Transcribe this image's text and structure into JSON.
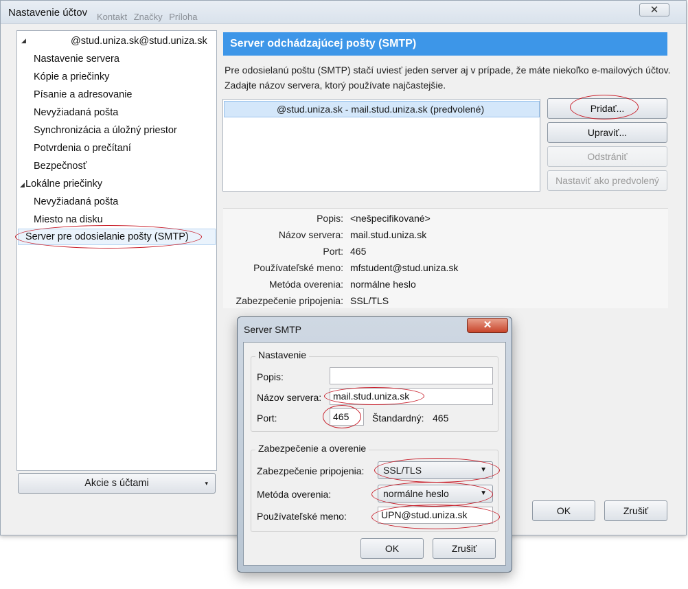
{
  "window": {
    "title": "Nastavenie účtov",
    "background_toolbar": [
      "Kontakt",
      "Značky",
      "Príloha"
    ],
    "close_glyph": "✕"
  },
  "sidebar": {
    "account": "@stud.uniza.sk@stud.uniza.sk",
    "account_items": [
      "Nastavenie servera",
      "Kópie a priečinky",
      "Písanie a adresovanie",
      "Nevyžiadaná pošta",
      "Synchronizácia a úložný priestor",
      "Potvrdenia o prečítaní",
      "Bezpečnosť"
    ],
    "local_folders": "Lokálne priečinky",
    "local_items": [
      "Nevyžiadaná pošta",
      "Miesto na disku"
    ],
    "smtp_item": "Server pre odosielanie pošty (SMTP)",
    "account_actions": "Akcie s účtami"
  },
  "smtp_panel": {
    "header": "Server odchádzajúcej pošty (SMTP)",
    "intro": "Pre odosielanú poštu (SMTP) stačí uviesť jeden server aj v prípade, že máte niekoľko e-mailových účtov. Zadajte názov servera, ktorý používate najčastejšie.",
    "server_entry": "@stud.uniza.sk - mail.stud.uniza.sk (predvolené)",
    "buttons": {
      "add": "Pridať...",
      "edit": "Upraviť...",
      "remove": "Odstrániť",
      "set_default": "Nastaviť ako predvolený"
    },
    "details": [
      {
        "label": "Popis:",
        "value": "<nešpecifikované>"
      },
      {
        "label": "Názov servera:",
        "value": "mail.stud.uniza.sk"
      },
      {
        "label": "Port:",
        "value": "465"
      },
      {
        "label": "Používateľské meno:",
        "value": "mfstudent@stud.uniza.sk"
      },
      {
        "label": "Metóda overenia:",
        "value": "normálne heslo"
      },
      {
        "label": "Zabezpečenie pripojenia:",
        "value": "SSL/TLS"
      }
    ]
  },
  "main_buttons": {
    "ok": "OK",
    "cancel": "Zrušiť"
  },
  "dialog": {
    "title": "Server SMTP",
    "close_glyph": "✕",
    "settings_group": "Nastavenie",
    "description_label": "Popis:",
    "description_value": "",
    "server_name_label": "Názov servera:",
    "server_name_value": "mail.stud.uniza.sk",
    "port_label": "Port:",
    "port_value": "465",
    "default_port_label": "Štandardný:",
    "default_port_value": "465",
    "security_group": "Zabezpečenie a overenie",
    "connection_security_label": "Zabezpečenie pripojenia:",
    "connection_security_value": "SSL/TLS",
    "auth_method_label": "Metóda overenia:",
    "auth_method_value": "normálne heslo",
    "username_label": "Používateľské meno:",
    "username_value": "UPN@stud.uniza.sk",
    "ok": "OK",
    "cancel": "Zrušiť"
  },
  "colors": {
    "header_blue": "#3d96e8",
    "selection": "#d4e7fa",
    "annotation_red": "#c81e2a"
  }
}
